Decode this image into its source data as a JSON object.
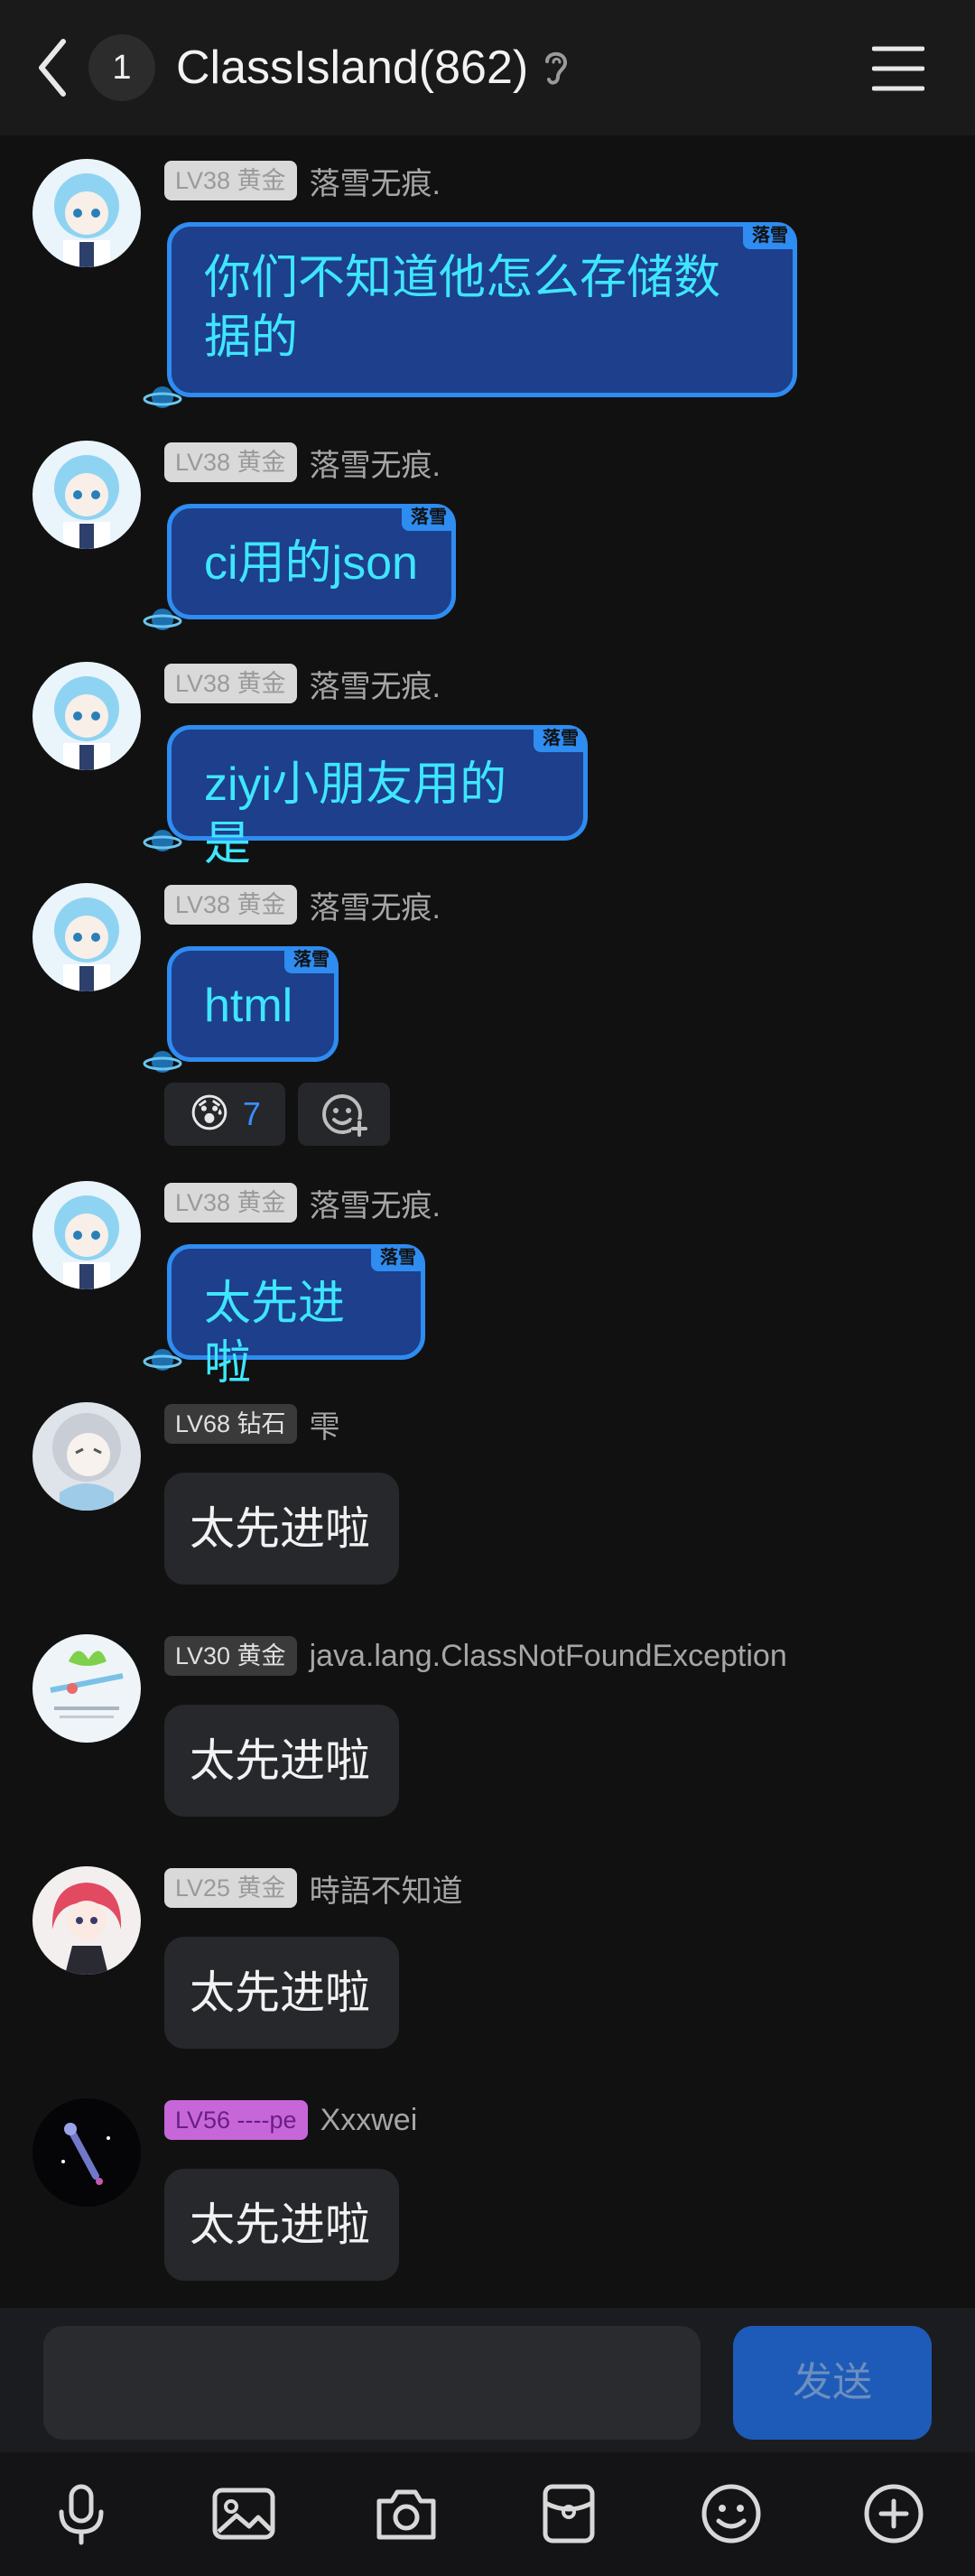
{
  "header": {
    "unread_count": "1",
    "title": "ClassIsland(862)"
  },
  "messages": [
    {
      "level": "LV38 黄金",
      "name": "落雪无痕.",
      "text_line1": "你们不知道他怎么存储数",
      "text_line2": "据的",
      "tag": "落雪"
    },
    {
      "level": "LV38 黄金",
      "name": "落雪无痕.",
      "text": "ci用的json",
      "tag": "落雪"
    },
    {
      "level": "LV38 黄金",
      "name": "落雪无痕.",
      "text": "ziyi小朋友用的是",
      "tag": "落雪"
    },
    {
      "level": "LV38 黄金",
      "name": "落雪无痕.",
      "text": "html",
      "tag": "落雪",
      "reaction_emoji": "😰",
      "reaction_count": "7"
    },
    {
      "level": "LV38 黄金",
      "name": "落雪无痕.",
      "text": "太先进啦",
      "tag": "落雪"
    },
    {
      "level": "LV68 钻石",
      "name": "雫",
      "text": "太先进啦"
    },
    {
      "level": "LV30 黄金",
      "name": "java.lang.ClassNotFoundException",
      "text": "太先进啦"
    },
    {
      "level": "LV25 黄金",
      "name": "時語不知道",
      "text": "太先进啦"
    },
    {
      "level": "LV56 ----pe",
      "name": "Xxxwei",
      "text": "太先进啦"
    }
  ],
  "input": {
    "value": "",
    "placeholder": ""
  },
  "send_label": "发送",
  "toolbar_icons": [
    "microphone-icon",
    "image-icon",
    "camera-icon",
    "red-packet-icon",
    "emoji-icon",
    "plus-icon"
  ],
  "colors": {
    "accent": "#2f8cf0",
    "bubble_text": "#3ee6ff",
    "background": "#111111"
  }
}
